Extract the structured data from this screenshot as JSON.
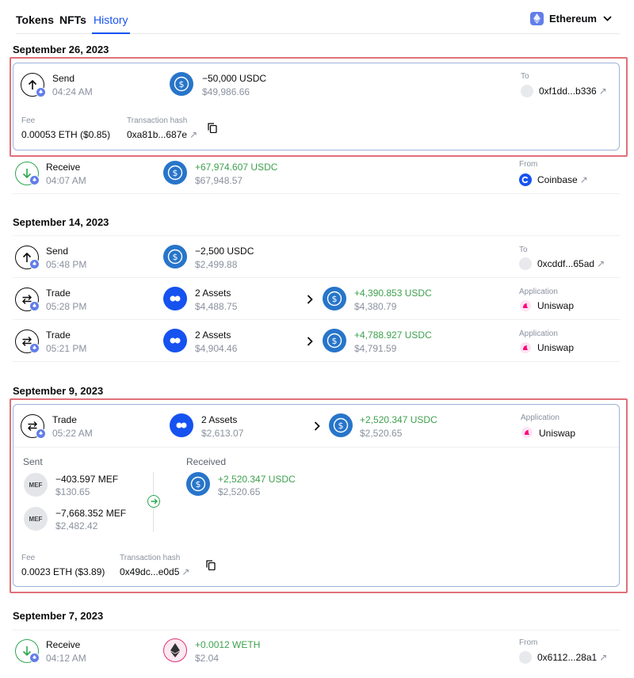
{
  "tabs": [
    {
      "label": "Tokens"
    },
    {
      "label": "NFTs"
    },
    {
      "label": "History"
    }
  ],
  "active_tab": "History",
  "chain_selector": {
    "label": "Ethereum",
    "icon": "ethereum-icon"
  },
  "groups": [
    {
      "date": "September 26, 2023",
      "rows": [
        {
          "type": "Send",
          "time": "04:24 AM",
          "amount": "−50,000 USDC",
          "fiat": "$49,986.66",
          "party_label": "To",
          "party": "0xf1dd...b336",
          "expanded": {
            "fee_label": "Fee",
            "fee": "0.00053 ETH ($0.85)",
            "hash_label": "Transaction hash",
            "hash": "0xa81b...687e"
          }
        },
        {
          "type": "Receive",
          "time": "04:07 AM",
          "amount": "+67,974.607 USDC",
          "fiat": "$67,948.57",
          "party_label": "From",
          "party": "Coinbase"
        }
      ]
    },
    {
      "date": "September 14, 2023",
      "rows": [
        {
          "type": "Send",
          "time": "05:48 PM",
          "amount": "−2,500 USDC",
          "fiat": "$2,499.88",
          "party_label": "To",
          "party": "0xcddf...65ad"
        },
        {
          "type": "Trade",
          "time": "05:28 PM",
          "amount": "2 Assets",
          "fiat": "$4,488.75",
          "to_amount": "+4,390.853 USDC",
          "to_fiat": "$4,380.79",
          "party_label": "Application",
          "party": "Uniswap"
        },
        {
          "type": "Trade",
          "time": "05:21 PM",
          "amount": "2 Assets",
          "fiat": "$4,904.46",
          "to_amount": "+4,788.927 USDC",
          "to_fiat": "$4,791.59",
          "party_label": "Application",
          "party": "Uniswap"
        }
      ]
    },
    {
      "date": "September 9, 2023",
      "rows": [
        {
          "type": "Trade",
          "time": "05:22 AM",
          "amount": "2 Assets",
          "fiat": "$2,613.07",
          "to_amount": "+2,520.347 USDC",
          "to_fiat": "$2,520.65",
          "party_label": "Application",
          "party": "Uniswap",
          "expanded": {
            "sent_label": "Sent",
            "sent": [
              {
                "token": "MEF",
                "amount": "−403.597 MEF",
                "fiat": "$130.65"
              },
              {
                "token": "MEF",
                "amount": "−7,668.352 MEF",
                "fiat": "$2,482.42"
              }
            ],
            "received_label": "Received",
            "received": [
              {
                "amount": "+2,520.347 USDC",
                "fiat": "$2,520.65"
              }
            ],
            "fee_label": "Fee",
            "fee": "0.0023 ETH ($3.89)",
            "hash_label": "Transaction hash",
            "hash": "0x49dc...e0d5"
          }
        }
      ]
    },
    {
      "date": "September 7, 2023",
      "rows": [
        {
          "type": "Receive",
          "time": "04:12 AM",
          "amount": "+0.0012 WETH",
          "fiat": "$2.04",
          "party_label": "From",
          "party": "0x6112...28a1"
        }
      ]
    }
  ],
  "colors": {
    "accent": "#1652f0",
    "positive": "#3ea14e",
    "usdc": "#2775ca",
    "ethereum": "#627eea",
    "highlight": "#e0707a"
  }
}
